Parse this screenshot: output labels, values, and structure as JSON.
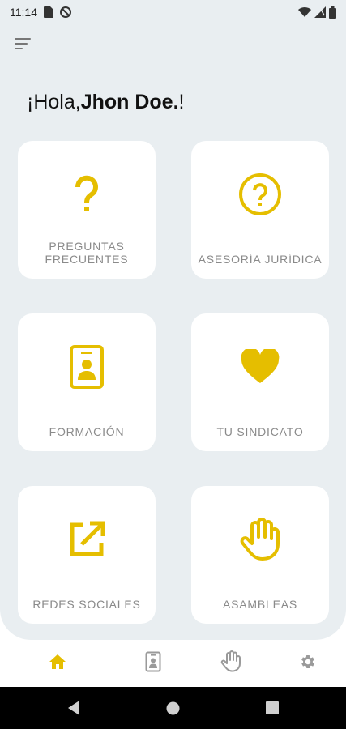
{
  "status_bar": {
    "time": "11:14"
  },
  "greeting": {
    "prefix": "¡Hola,",
    "name": "Jhon Doe.",
    "suffix": "!"
  },
  "cards": [
    {
      "label": "PREGUNTAS\nFRECUENTES",
      "icon": "question-mark-icon"
    },
    {
      "label": "ASESORÍA JURÍDICA",
      "icon": "question-circle-icon"
    },
    {
      "label": "FORMACIÓN",
      "icon": "id-badge-icon"
    },
    {
      "label": "TU SINDICATO",
      "icon": "heart-icon"
    },
    {
      "label": "REDES SOCIALES",
      "icon": "external-link-icon"
    },
    {
      "label": "ASAMBLEAS",
      "icon": "hand-icon"
    }
  ],
  "bottom_nav": [
    {
      "name": "home-icon",
      "active": true
    },
    {
      "name": "id-badge-icon",
      "active": false
    },
    {
      "name": "hand-icon",
      "active": false
    },
    {
      "name": "gear-icon",
      "active": false
    }
  ],
  "colors": {
    "accent": "#E5BE00",
    "background": "#E9EEF1",
    "label": "#8A8A8A",
    "inactive_icon": "#9A9A9A"
  }
}
